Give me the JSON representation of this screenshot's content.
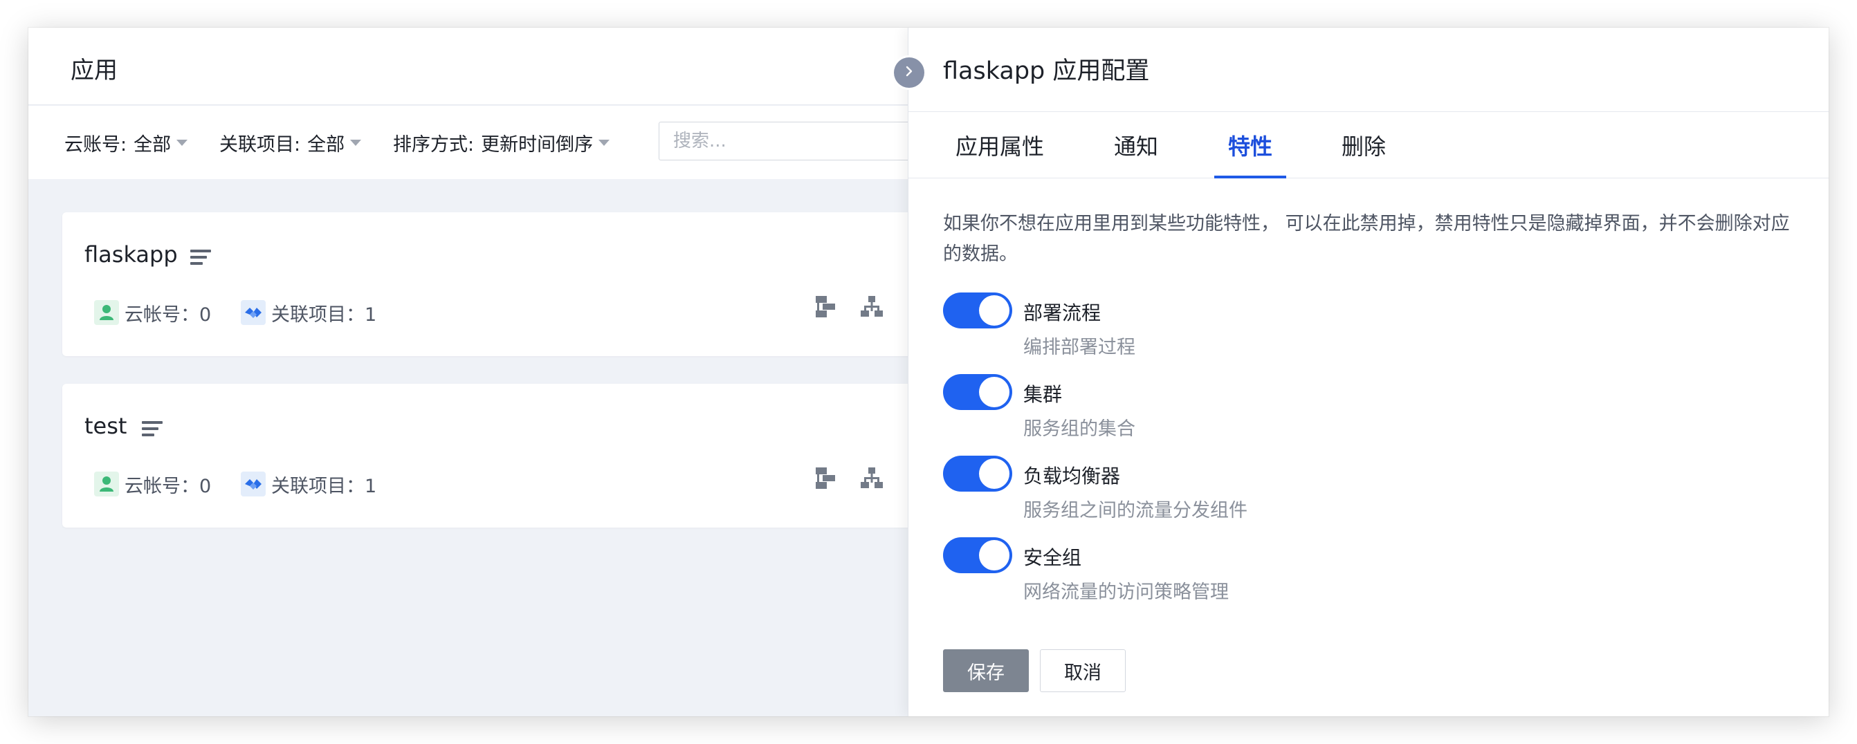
{
  "app": {
    "title": "应用"
  },
  "filters": {
    "account_label": "云账号:",
    "account_value": "全部",
    "project_label": "关联项目:",
    "project_value": "全部",
    "sort_label": "排序方式:",
    "sort_value": "更新时间倒序",
    "search_placeholder": "搜索..."
  },
  "cards": [
    {
      "name": "flaskapp",
      "account_meta": "云帐号：0",
      "project_meta": "关联项目：1"
    },
    {
      "name": "test",
      "account_meta": "云帐号：0",
      "project_meta": "关联项目：1"
    }
  ],
  "drawer": {
    "title": "flaskapp 应用配置",
    "tabs": [
      {
        "label": "应用属性"
      },
      {
        "label": "通知"
      },
      {
        "label": "特性",
        "active": true
      },
      {
        "label": "删除"
      }
    ],
    "description": "如果你不想在应用里用到某些功能特性， 可以在此禁用掉，禁用特性只是隐藏掉界面，并不会删除对应的数据。",
    "features": [
      {
        "name": "部署流程",
        "desc": "编排部署过程",
        "enabled": true
      },
      {
        "name": "集群",
        "desc": "服务组的集合",
        "enabled": true
      },
      {
        "name": "负载均衡器",
        "desc": "服务组之间的流量分发组件",
        "enabled": true
      },
      {
        "name": "安全组",
        "desc": "网络流量的访问策略管理",
        "enabled": true
      }
    ],
    "save_label": "保存",
    "cancel_label": "取消"
  },
  "colors": {
    "accent": "#1f62f0",
    "tab_active": "#1d4fdc",
    "save_button": "#7d8591",
    "background": "#eff2f7"
  },
  "icons": {
    "collapse": "chevron-right-icon",
    "card_list": "list-icon",
    "card_more": "more-icon",
    "account": "user-icon",
    "project": "link-icon",
    "pipeline": "pipeline-icon",
    "topology": "topology-icon",
    "settings": "gear-icon"
  }
}
